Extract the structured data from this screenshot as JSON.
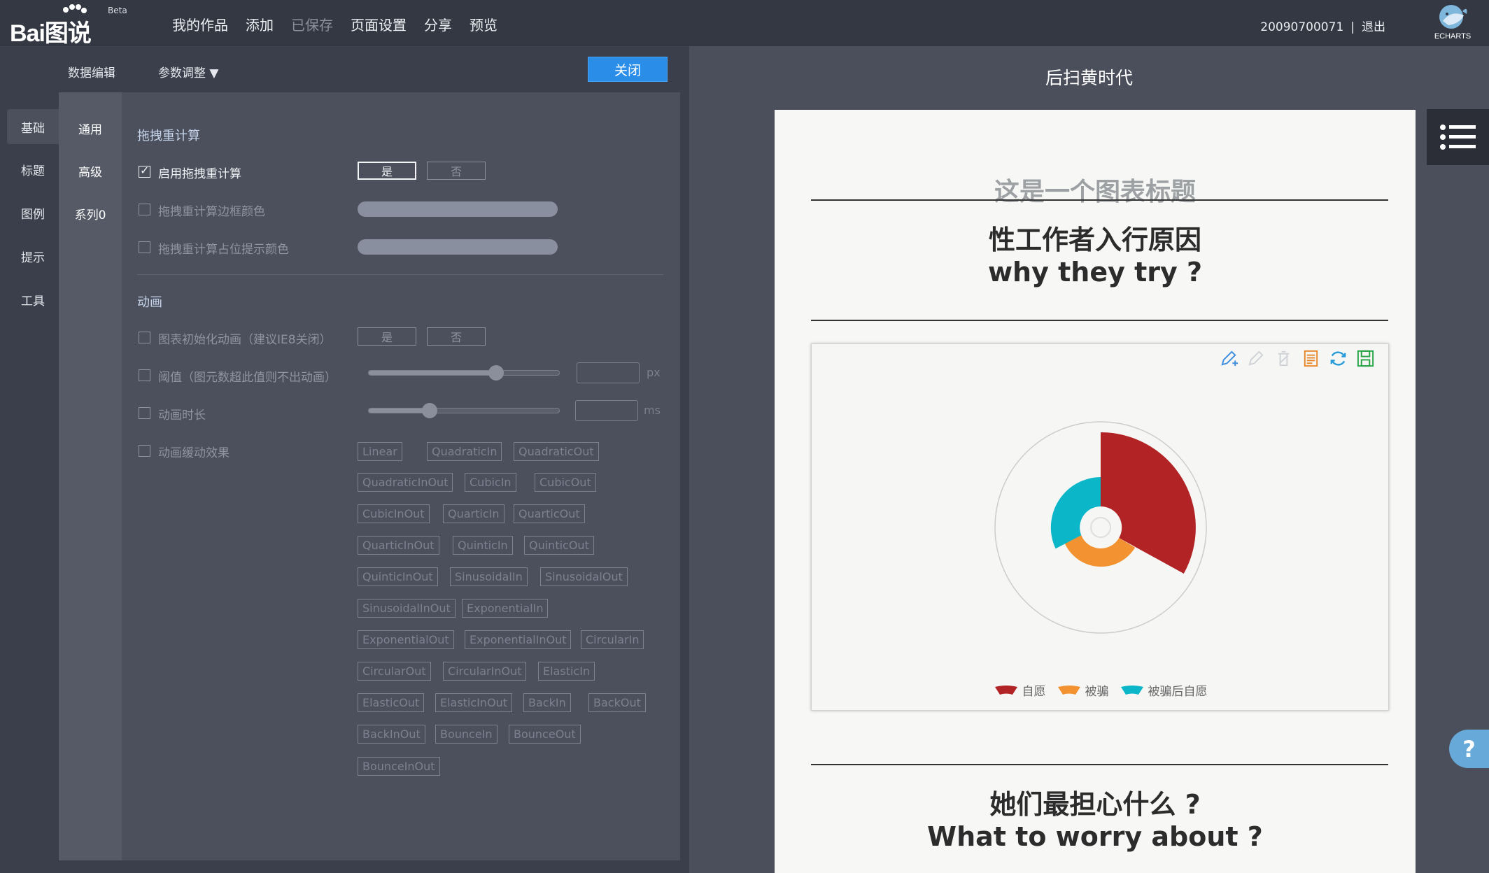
{
  "app": {
    "logo_text": "Bai图说",
    "logo_beta": "Beta",
    "nav": [
      "我的作品",
      "添加",
      "已保存",
      "页面设置",
      "分享",
      "预览"
    ],
    "user_id": "20090700071",
    "user_sep": "|",
    "logout": "退出",
    "echarts_label": "ECHARTS"
  },
  "editor": {
    "tabs": {
      "data_edit": "数据编辑",
      "params": "参数调整 ▼"
    },
    "close": "关闭",
    "left_menu": [
      "基础",
      "标题",
      "图例",
      "提示",
      "工具"
    ],
    "second_menu": [
      "通用",
      "高级",
      "系列0"
    ],
    "drag": {
      "section": "拖拽重计算",
      "enable": "启用拖拽重计算",
      "border_color": "拖拽重计算边框颜色",
      "placeholder_color": "拖拽重计算占位提示颜色",
      "yes": "是",
      "no": "否"
    },
    "animation": {
      "section": "动画",
      "init": "图表初始化动画（建议IE8关闭）",
      "threshold": "阈值（图元数超此值则不出动画）",
      "threshold_unit": "px",
      "duration": "动画时长",
      "duration_unit": "ms",
      "easing": "动画缓动效果",
      "yes": "是",
      "no": "否",
      "threshold_level": 0.67,
      "duration_level": 0.32
    },
    "easings": [
      "Linear",
      "QuadraticIn",
      "QuadraticOut",
      "QuadraticInOut",
      "CubicIn",
      "CubicOut",
      "CubicInOut",
      "QuarticIn",
      "QuarticOut",
      "QuarticInOut",
      "QuinticIn",
      "QuinticOut",
      "QuinticInOut",
      "SinusoidalIn",
      "SinusoidalOut",
      "SinusoidalInOut",
      "ExponentialIn",
      "ExponentialOut",
      "ExponentialInOut",
      "CircularIn",
      "CircularOut",
      "CircularInOut",
      "ElasticIn",
      "ElasticOut",
      "ElasticInOut",
      "BackIn",
      "BackOut",
      "BackInOut",
      "BounceIn",
      "BounceOut",
      "BounceInOut"
    ]
  },
  "preview": {
    "page_title": "后扫黄时代",
    "card_title": "这是一个图表标题",
    "heading1_cn": "性工作者入行原因",
    "heading1_en": "why they try ?",
    "heading2_cn": "她们最担心什么 ?",
    "heading2_en": "What to worry about ?",
    "legend": [
      {
        "name": "自愿",
        "color": "#b22325"
      },
      {
        "name": "被骗",
        "color": "#f39230"
      },
      {
        "name": "被骗后自愿",
        "color": "#0cb6c9"
      }
    ],
    "help": "?"
  },
  "icons": [
    "pencil-plus-icon",
    "pencil-icon",
    "trash-icon",
    "data-view-icon",
    "refresh-icon",
    "save-icon",
    "list-menu-icon"
  ]
}
